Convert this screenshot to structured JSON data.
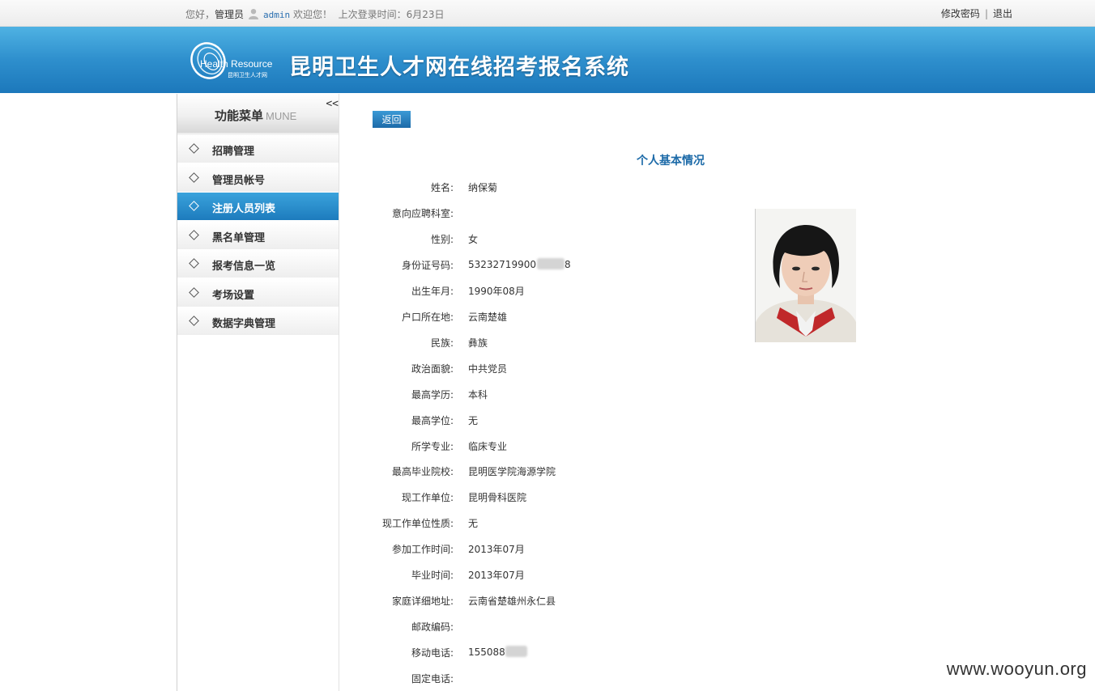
{
  "topbar": {
    "greeting": "您好，",
    "role": "管理员",
    "username": "admin",
    "welcome": "欢迎您！",
    "last_login_label": "上次登录时间：",
    "last_login_value": "6月23日",
    "change_password": "修改密码",
    "separator": "|",
    "logout": "退出"
  },
  "banner": {
    "logo_en": "Health Resource",
    "logo_cn": "昆明卫生人才网",
    "system_title": "昆明卫生人才网在线招考报名系统"
  },
  "sidebar": {
    "title": "功能菜单",
    "title_en": "MUNE",
    "collapse": "<<",
    "items": [
      {
        "label": "招聘管理",
        "active": false
      },
      {
        "label": "管理员帐号",
        "active": false
      },
      {
        "label": "注册人员列表",
        "active": true
      },
      {
        "label": "黑名单管理",
        "active": false
      },
      {
        "label": "报考信息一览",
        "active": false
      },
      {
        "label": "考场设置",
        "active": false
      },
      {
        "label": "数据字典管理",
        "active": false
      }
    ]
  },
  "main": {
    "back_button": "返回",
    "section_title": "个人基本情况",
    "fields": [
      {
        "label": "姓名:",
        "value": "纳保菊"
      },
      {
        "label": "意向应聘科室:",
        "value": ""
      },
      {
        "label": "性别:",
        "value": "女"
      },
      {
        "label": "身份证号码:",
        "value": "53232719900",
        "value_tail": "8",
        "redacted": true
      },
      {
        "label": "出生年月:",
        "value": "1990年08月"
      },
      {
        "label": "户口所在地:",
        "value": "云南楚雄"
      },
      {
        "label": "民族:",
        "value": "彝族"
      },
      {
        "label": "政治面貌:",
        "value": "中共党员"
      },
      {
        "label": "最高学历:",
        "value": "本科"
      },
      {
        "label": "最高学位:",
        "value": "无"
      },
      {
        "label": "所学专业:",
        "value": "临床专业"
      },
      {
        "label": "最高毕业院校:",
        "value": "昆明医学院海源学院"
      },
      {
        "label": "现工作单位:",
        "value": "昆明骨科医院"
      },
      {
        "label": "现工作单位性质:",
        "value": "无"
      },
      {
        "label": "参加工作时间:",
        "value": "2013年07月"
      },
      {
        "label": "毕业时间:",
        "value": "2013年07月"
      },
      {
        "label": "家庭详细地址:",
        "value": "云南省楚雄州永仁县"
      },
      {
        "label": "邮政编码:",
        "value": ""
      },
      {
        "label": "移动电话:",
        "value": "155088",
        "value_tail": "",
        "redacted": true
      },
      {
        "label": "固定电话:",
        "value": ""
      }
    ]
  },
  "watermark": "www.wooyun.org",
  "colors": {
    "banner": "#2e8fcd",
    "active_menu": "#1d7bbd",
    "title_text": "#1c6aa8"
  }
}
